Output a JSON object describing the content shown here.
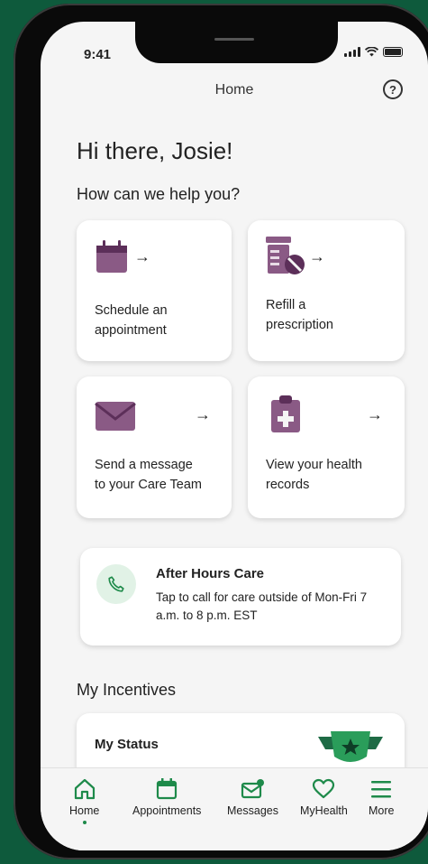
{
  "status_bar": {
    "time": "9:41"
  },
  "header": {
    "title": "Home"
  },
  "greeting": "Hi there, Josie!",
  "help_section": {
    "title": "How can we help you?",
    "cards": [
      {
        "label": "Schedule an\nappointment",
        "icon": "calendar-icon"
      },
      {
        "label": "Refill a\nprescription",
        "icon": "prescription-icon"
      },
      {
        "label": "Send a message\nto your Care Team",
        "icon": "envelope-icon"
      },
      {
        "label": "View your health\nrecords",
        "icon": "clipboard-medical-icon"
      }
    ]
  },
  "after_hours": {
    "title": "After Hours Care",
    "description": "Tap to call for care outside of Mon-Fri 7 a.m. to 8 p.m. EST"
  },
  "incentives": {
    "title": "My Incentives",
    "status_title": "My Status"
  },
  "tab_bar": {
    "items": [
      {
        "label": "Home",
        "icon": "home-icon",
        "active": true
      },
      {
        "label": "Appointments",
        "icon": "calendar-icon"
      },
      {
        "label": "Messages",
        "icon": "message-icon"
      },
      {
        "label": "MyHealth",
        "icon": "heart-icon"
      },
      {
        "label": "More",
        "icon": "menu-icon"
      }
    ]
  },
  "colors": {
    "background": "#0e5a3c",
    "accent_purple": "#8a5a85",
    "accent_green": "#1e8a4a",
    "badge_green": "#2a9d5a"
  }
}
